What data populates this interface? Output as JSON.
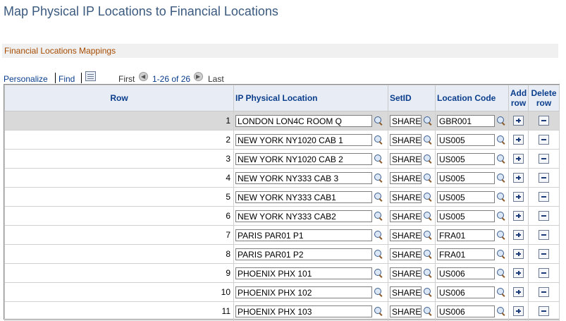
{
  "page": {
    "title": "Map Physical IP Locations to Financial Locations"
  },
  "section": {
    "title": "Financial Locations Mappings"
  },
  "nav": {
    "personalize": "Personalize",
    "find": "Find",
    "first": "First",
    "count": "1-26 of 26",
    "last": "Last"
  },
  "table": {
    "headers": {
      "row": "Row",
      "ip_location": "IP Physical Location",
      "setid": "SetID",
      "location_code": "Location Code",
      "add_row_1": "Add",
      "add_row_2": "row",
      "delete_row_1": "Delete",
      "delete_row_2": "row"
    },
    "rows": [
      {
        "num": "1",
        "ip_location": "LONDON LON4C ROOM Q",
        "setid": "SHARE",
        "location_code": "GBR001"
      },
      {
        "num": "2",
        "ip_location": "NEW YORK NY1020 CAB 1",
        "setid": "SHARE",
        "location_code": "US005"
      },
      {
        "num": "3",
        "ip_location": "NEW YORK NY1020 CAB 2",
        "setid": "SHARE",
        "location_code": "US005"
      },
      {
        "num": "4",
        "ip_location": "NEW YORK NY333 CAB 3",
        "setid": "SHARE",
        "location_code": "US005"
      },
      {
        "num": "5",
        "ip_location": "NEW YORK NY333 CAB1",
        "setid": "SHARE",
        "location_code": "US005"
      },
      {
        "num": "6",
        "ip_location": "NEW YORK NY333 CAB2",
        "setid": "SHARE",
        "location_code": "US005"
      },
      {
        "num": "7",
        "ip_location": "PARIS PAR01 P1",
        "setid": "SHARE",
        "location_code": "FRA01"
      },
      {
        "num": "8",
        "ip_location": "PARIS PAR01 P2",
        "setid": "SHARE",
        "location_code": "FRA01"
      },
      {
        "num": "9",
        "ip_location": "PHOENIX PHX 101",
        "setid": "SHARE",
        "location_code": "US006"
      },
      {
        "num": "10",
        "ip_location": "PHOENIX PHX 102",
        "setid": "SHARE",
        "location_code": "US006"
      },
      {
        "num": "11",
        "ip_location": "PHOENIX PHX 103",
        "setid": "SHARE",
        "location_code": "US006"
      }
    ]
  }
}
